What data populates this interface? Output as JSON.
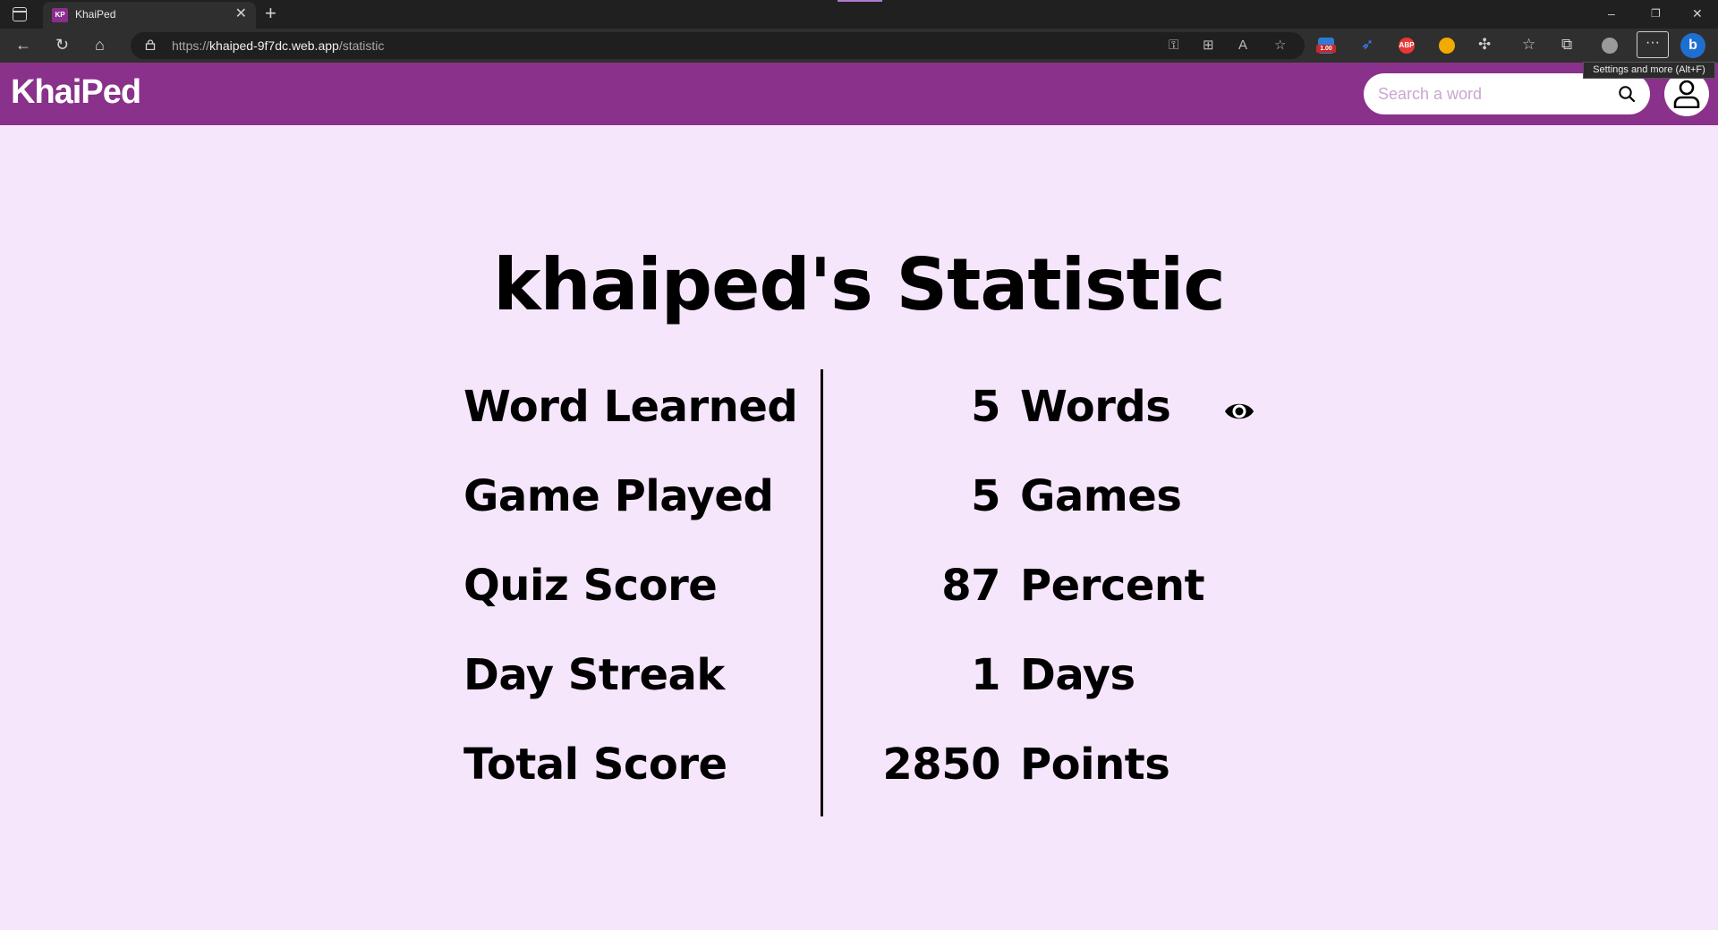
{
  "browser": {
    "tab_title": "KhaiPed",
    "tab_favicon_text": "KP",
    "url_scheme": "https://",
    "url_host": "khaiped-9f7dc.web.app",
    "url_path": "/statistic",
    "extension_badge": "1.00",
    "abp_label": "ABP",
    "tooltip": "Settings and more (Alt+F)",
    "more_label": "···"
  },
  "app": {
    "logo": "KhaiPed",
    "search_placeholder": "Search a word",
    "search_value": "",
    "accent_color": "#89318b",
    "background_color": "#f6e6fc"
  },
  "main": {
    "title": "khaiped's Statistic",
    "stats": [
      {
        "label": "Word Learned",
        "value": "5",
        "unit": "Words"
      },
      {
        "label": "Game Played",
        "value": "5",
        "unit": "Games"
      },
      {
        "label": "Quiz Score",
        "value": "87",
        "unit": "Percent"
      },
      {
        "label": "Day Streak",
        "value": "1",
        "unit": "Days"
      },
      {
        "label": "Total Score",
        "value": "2850",
        "unit": "Points"
      }
    ],
    "view_icon": "eye-icon"
  }
}
